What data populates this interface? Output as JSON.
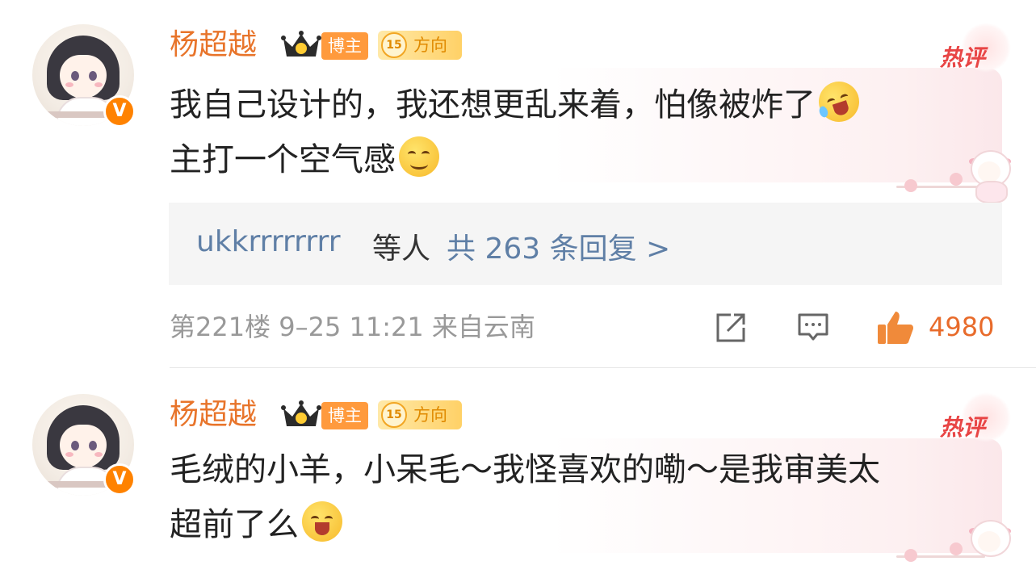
{
  "comments": [
    {
      "username": "杨超越",
      "badge_blogger": "博主",
      "badge_level": "15",
      "badge_direction": "方向",
      "hot_label": "热评",
      "text_line1": "我自己设计的，我还想更乱来着，怕像被炸了",
      "text_line2": "主打一个空气感",
      "emoji1": "rolling-on-floor-laughing-emoji",
      "emoji2": "smiling-face-emoji",
      "replies": {
        "user": "ukkrrrrrrrr",
        "etc": "等人",
        "count": "共 263 条回复 >"
      },
      "meta": "第221楼 9–25 11:21 来自云南",
      "likes": "4980"
    },
    {
      "username": "杨超越",
      "badge_blogger": "博主",
      "badge_level": "15",
      "badge_direction": "方向",
      "hot_label": "热评",
      "text_line1": "毛绒的小羊，小呆毛～我怪喜欢的嘞～是我审美太",
      "text_line2": "超前了么",
      "emoji1": "happy-sweat-emoji"
    }
  ],
  "colors": {
    "username": "#e8742a",
    "link": "#5f7fa6",
    "hot": "#e84545",
    "like": "#e86b2b"
  }
}
